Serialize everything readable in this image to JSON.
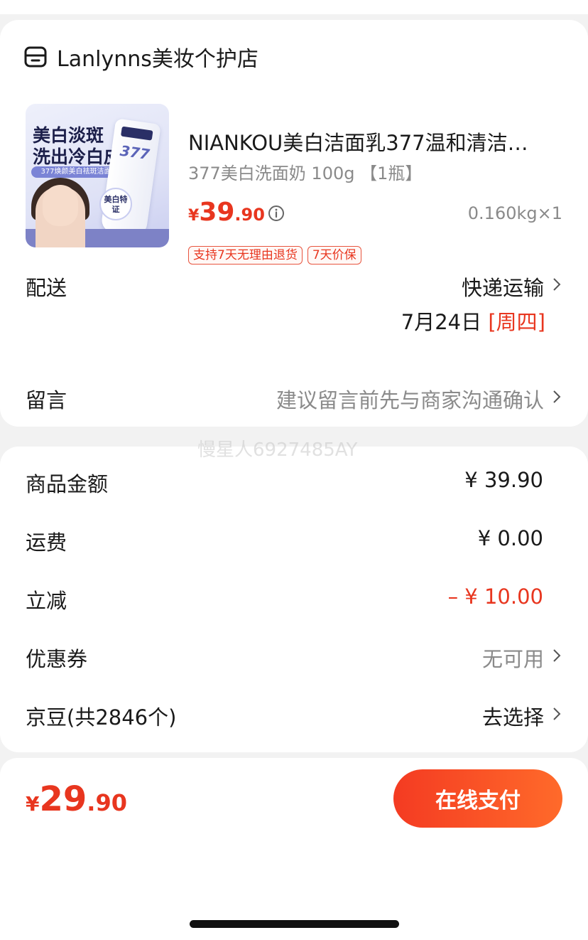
{
  "shop": {
    "name": "Lanlynns美妆个护店",
    "icon": "shop-icon"
  },
  "product": {
    "title": "NIANKOU美白洁面乳377温和清洁…",
    "spec": "377美白洗面奶 100g 【1瓶】",
    "price": {
      "yen": "¥",
      "integer": "39",
      "decimal": ".90"
    },
    "weight": "0.160kg×1",
    "tags": [
      "支持7天无理由退货",
      "7天价保"
    ],
    "image": {
      "headline_line1": "美白淡斑",
      "headline_line2": "洗出冷白皮",
      "sub": "377焕颜美白祛斑洁面乳",
      "tube_number": "377",
      "badge": "美白特证"
    }
  },
  "delivery": {
    "label": "配送",
    "method": "快递运输",
    "date": "7月24日",
    "weekday": "[周四]"
  },
  "message": {
    "label": "留言",
    "placeholder": "建议留言前先与商家沟通确认"
  },
  "watermark": "慢星人6927485AY",
  "fees": {
    "goods_label": "商品金额",
    "goods_value": "¥ 39.90",
    "shipping_label": "运费",
    "shipping_value": "¥ 0.00",
    "discount_label": "立减",
    "discount_value": "– ¥ 10.00",
    "coupon_label": "优惠券",
    "coupon_value": "无可用",
    "beans_label": "京豆(共2846个)",
    "beans_value": "去选择"
  },
  "footer": {
    "total": {
      "yen": "¥",
      "integer": "29",
      "decimal": ".90"
    },
    "pay_label": "在线支付"
  },
  "colors": {
    "accent": "#e8361f",
    "muted": "#8a8a8a",
    "background": "#f2f2f2"
  }
}
